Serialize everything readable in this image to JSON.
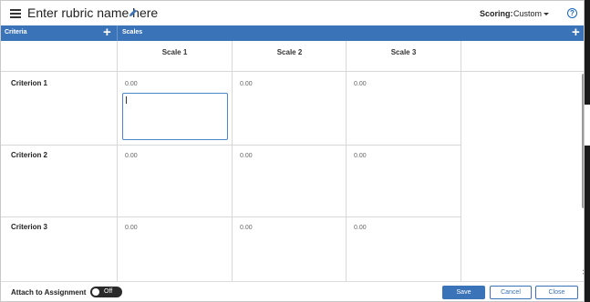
{
  "header": {
    "title": "Enter rubric name here",
    "scoring_label": "Scoring:",
    "scoring_value": "Custom",
    "help_symbol": "?"
  },
  "bar": {
    "criteria_label": "Criteria",
    "scales_label": "Scales",
    "plus_symbol": "+"
  },
  "scales": [
    "Scale 1",
    "Scale 2",
    "Scale 3"
  ],
  "criteria": [
    {
      "name": "Criterion 1",
      "scores": [
        "0.00",
        "0.00",
        "0.00"
      ]
    },
    {
      "name": "Criterion 2",
      "scores": [
        "0.00",
        "0.00",
        "0.00"
      ]
    },
    {
      "name": "Criterion 3",
      "scores": [
        "0.00",
        "0.00",
        "0.00"
      ]
    }
  ],
  "footer": {
    "attach_label": "Attach to Assignment",
    "toggle_text": "Off",
    "save_label": "Save",
    "cancel_label": "Cancel",
    "close_label": "Close"
  },
  "colors": {
    "accent": "#3b73b9",
    "toggle_bg": "#2b2b2b"
  },
  "icons": {
    "menu": "hamburger-icon",
    "edit": "pencil-icon",
    "add": "plus-icon",
    "help": "help-icon"
  }
}
